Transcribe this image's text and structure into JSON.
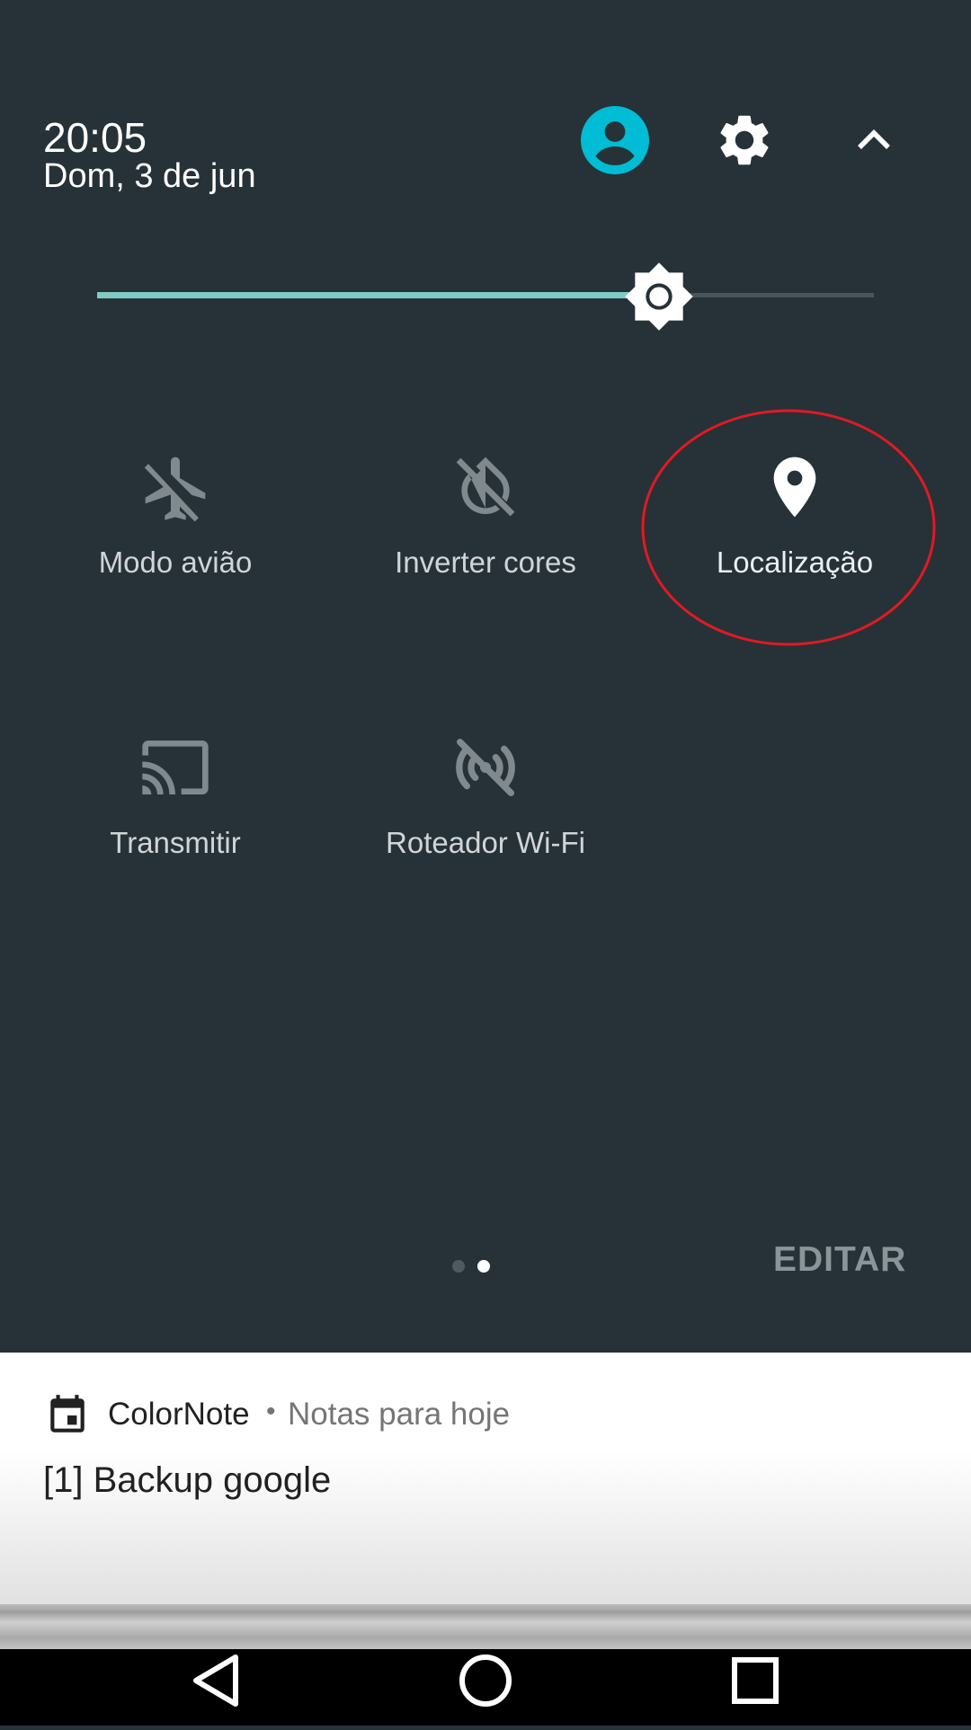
{
  "status": {
    "time": "20:05",
    "date": "Dom, 3 de jun"
  },
  "header": {
    "user_icon": "account-circle-icon",
    "settings_icon": "gear-icon",
    "collapse_icon": "chevron-up-icon",
    "accent": "#00BCD4"
  },
  "brightness": {
    "level": 0.72,
    "icon": "brightness-icon",
    "accent": "#80CBC4"
  },
  "tiles": [
    {
      "label": "Modo avião",
      "icon": "airplane-off-icon",
      "active": false
    },
    {
      "label": "Inverter cores",
      "icon": "invert-colors-off-icon",
      "active": false
    },
    {
      "label": "Localização",
      "icon": "location-pin-icon",
      "active": true
    },
    {
      "label": "Transmitir",
      "icon": "cast-icon",
      "active": false
    },
    {
      "label": "Roteador Wi-Fi",
      "icon": "hotspot-off-icon",
      "active": false
    }
  ],
  "pager": {
    "pages": 2,
    "current": 2
  },
  "edit_label": "EDITAR",
  "annotation": {
    "color": "#E11A22"
  },
  "notification": {
    "app": "ColorNote",
    "separator": "•",
    "subtitle": "Notas para hoje",
    "body": "[1] Backup google",
    "icon": "calendar-icon"
  },
  "navbar": {
    "back_icon": "back-triangle-icon",
    "home_icon": "home-circle-icon",
    "recents_icon": "recents-square-icon"
  }
}
